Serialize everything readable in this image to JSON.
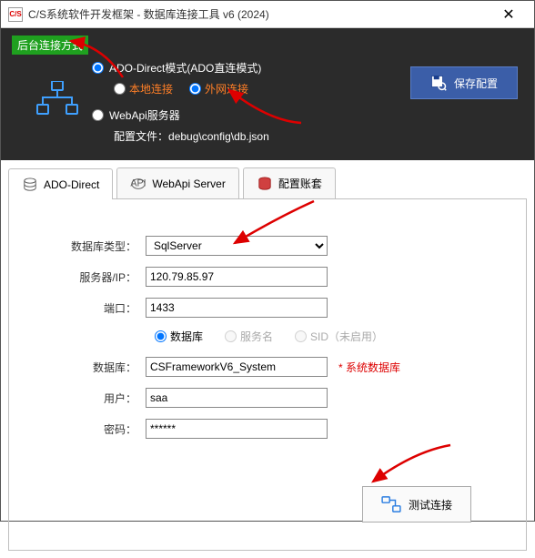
{
  "title": "C/S系统软件开发框架 - 数据库连接工具 v6 (2024)",
  "app_icon_text": "C/S",
  "badge": "后台连接方式",
  "radios": {
    "ado": "ADO-Direct模式(ADO直连模式)",
    "local": "本地连接",
    "external": "外网连接",
    "webapi": "WebApi服务器"
  },
  "config_label": "配置文件：",
  "config_path": "debug\\config\\db.json",
  "save_btn": "保存配置",
  "tabs": {
    "ado": "ADO-Direct",
    "webapi": "WebApi Server",
    "account": "配置账套"
  },
  "form": {
    "db_type_label": "数据库类型：",
    "db_type_value": "SqlServer",
    "server_label": "服务器/IP：",
    "server_value": "120.79.85.97",
    "port_label": "端口：",
    "port_value": "1433",
    "mode_db": "数据库",
    "mode_service": "服务名",
    "mode_sid": "SID（未启用）",
    "db_label": "数据库：",
    "db_value": "CSFrameworkV6_System",
    "db_note": "* 系统数据库",
    "user_label": "用户：",
    "user_value": "saa",
    "pwd_label": "密码：",
    "pwd_value": "******"
  },
  "test_btn": "测试连接"
}
